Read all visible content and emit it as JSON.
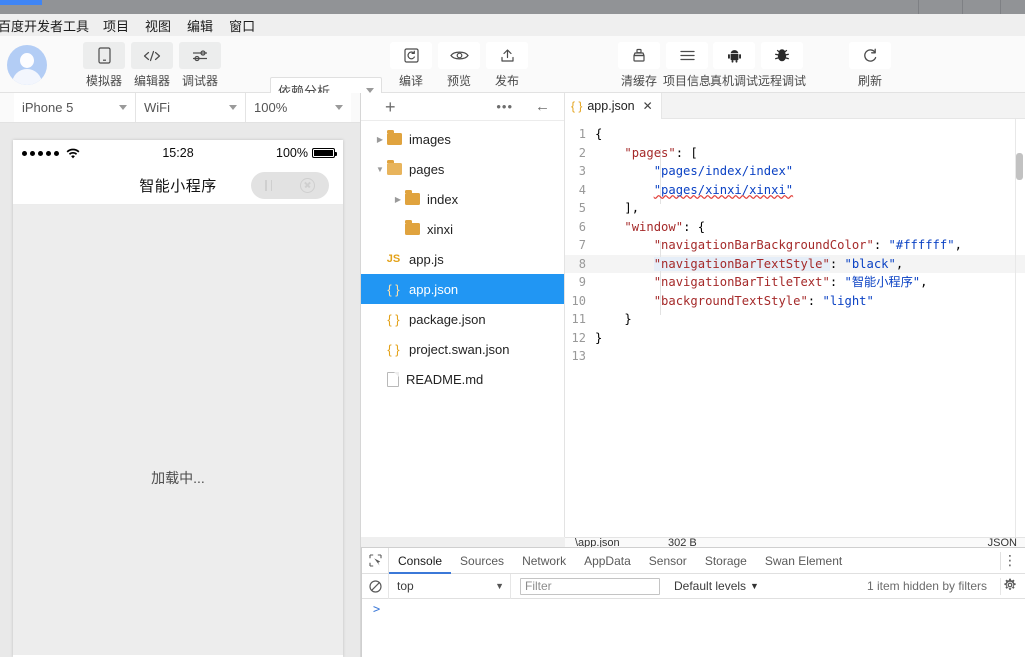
{
  "window": {
    "title_accent_color": "#3f85f5",
    "titlebar_color": "#919396"
  },
  "menubar": {
    "brand": "百度开发者工具",
    "items": [
      "项目",
      "视图",
      "编辑",
      "窗口"
    ]
  },
  "toolbar": {
    "mode_buttons": [
      {
        "label": "模拟器",
        "icon": "phone-icon"
      },
      {
        "label": "编辑器",
        "icon": "code-icon"
      },
      {
        "label": "调试器",
        "icon": "sliders-icon"
      }
    ],
    "analysis_select": {
      "value": "依赖分析",
      "icon": "chevron-down-icon"
    },
    "action_buttons": [
      {
        "label": "编译",
        "icon": "compile-icon"
      },
      {
        "label": "预览",
        "icon": "eye-icon"
      },
      {
        "label": "发布",
        "icon": "upload-icon"
      }
    ],
    "project_buttons": [
      {
        "label": "清缓存",
        "icon": "broom-icon"
      },
      {
        "label": "项目信息",
        "icon": "hamburger-icon"
      }
    ],
    "debug_buttons": [
      {
        "label": "真机调试",
        "icon": "android-icon"
      },
      {
        "label": "远程调试",
        "icon": "bug-icon"
      }
    ],
    "refresh_button": {
      "label": "刷新",
      "icon": "refresh-icon"
    }
  },
  "simulator": {
    "device_select": {
      "value": "iPhone 5",
      "icon": "chevron-down-icon"
    },
    "network_select": {
      "value": "WiFi",
      "icon": "chevron-down-icon"
    },
    "scale_select": {
      "value": "100%",
      "icon": "chevron-down-icon"
    },
    "status_bar": {
      "signal_dots": 5,
      "wifi_icon": "wifi-icon",
      "time": "15:28",
      "battery_percent": "100%",
      "battery_icon": "battery-full-icon"
    },
    "nav_title": "智能小程序",
    "capsule": {
      "more_icon": "more-icon",
      "close_icon": "close-circle-icon"
    },
    "page_content": "加载中..."
  },
  "filetree": {
    "header": {
      "add_icon": "plus-icon",
      "more_icon": "ellipsis-icon",
      "collapse_icon": "arrow-left-icon"
    },
    "nodes": [
      {
        "name": "images",
        "type": "folder",
        "depth": 0,
        "arrow": "collapsed",
        "selected": false
      },
      {
        "name": "pages",
        "type": "folder-open",
        "depth": 0,
        "arrow": "expanded",
        "selected": false
      },
      {
        "name": "index",
        "type": "folder",
        "depth": 1,
        "arrow": "collapsed",
        "selected": false
      },
      {
        "name": "xinxi",
        "type": "folder",
        "depth": 1,
        "arrow": "none",
        "selected": false
      },
      {
        "name": "app.js",
        "type": "js",
        "depth": 0,
        "arrow": "none",
        "selected": false
      },
      {
        "name": "app.json",
        "type": "json",
        "depth": 0,
        "arrow": "none",
        "selected": true
      },
      {
        "name": "package.json",
        "type": "json",
        "depth": 0,
        "arrow": "none",
        "selected": false
      },
      {
        "name": "project.swan.json",
        "type": "json",
        "depth": 0,
        "arrow": "none",
        "selected": false
      },
      {
        "name": "README.md",
        "type": "doc",
        "depth": 0,
        "arrow": "none",
        "selected": false
      }
    ]
  },
  "editor": {
    "tab": {
      "label": "app.json",
      "icon": "json-braces-icon",
      "close_icon": "close-icon"
    },
    "lines": [
      {
        "n": "1",
        "text": "{"
      },
      {
        "n": "2",
        "text": "    \"pages\": ["
      },
      {
        "n": "3",
        "text": "        \"pages/index/index\""
      },
      {
        "n": "4",
        "text": "        \"pages/xinxi/xinxi\""
      },
      {
        "n": "5",
        "text": "    ],"
      },
      {
        "n": "6",
        "text": "    \"window\": {"
      },
      {
        "n": "7",
        "text": "        \"navigationBarBackgroundColor\": \"#ffffff\","
      },
      {
        "n": "8",
        "text": "        \"navigationBarTextStyle\": \"black\","
      },
      {
        "n": "9",
        "text": "        \"navigationBarTitleText\": \"智能小程序\","
      },
      {
        "n": "10",
        "text": "        \"backgroundTextStyle\": \"light\""
      },
      {
        "n": "11",
        "text": "    }"
      },
      {
        "n": "12",
        "text": "}"
      },
      {
        "n": "13",
        "text": ""
      }
    ],
    "status": {
      "file": "\\app.json",
      "size": "302 B",
      "language": "JSON"
    }
  },
  "devtools": {
    "inspect_icon": "cursor-select-icon",
    "tabs": [
      "Console",
      "Sources",
      "Network",
      "AppData",
      "Sensor",
      "Storage",
      "Swan Element"
    ],
    "active_tab": "Console",
    "menu_icon": "kebab-menu-icon",
    "clear_icon": "clear-console-icon",
    "context_select": {
      "value": "top",
      "icon": "chevron-down-icon"
    },
    "filter_input": {
      "value": "",
      "placeholder": "Filter"
    },
    "levels_select": {
      "value": "Default levels",
      "icon": "chevron-down-icon"
    },
    "hidden_message": "1 item hidden by filters",
    "settings_icon": "gear-icon",
    "prompt_symbol": ">"
  }
}
